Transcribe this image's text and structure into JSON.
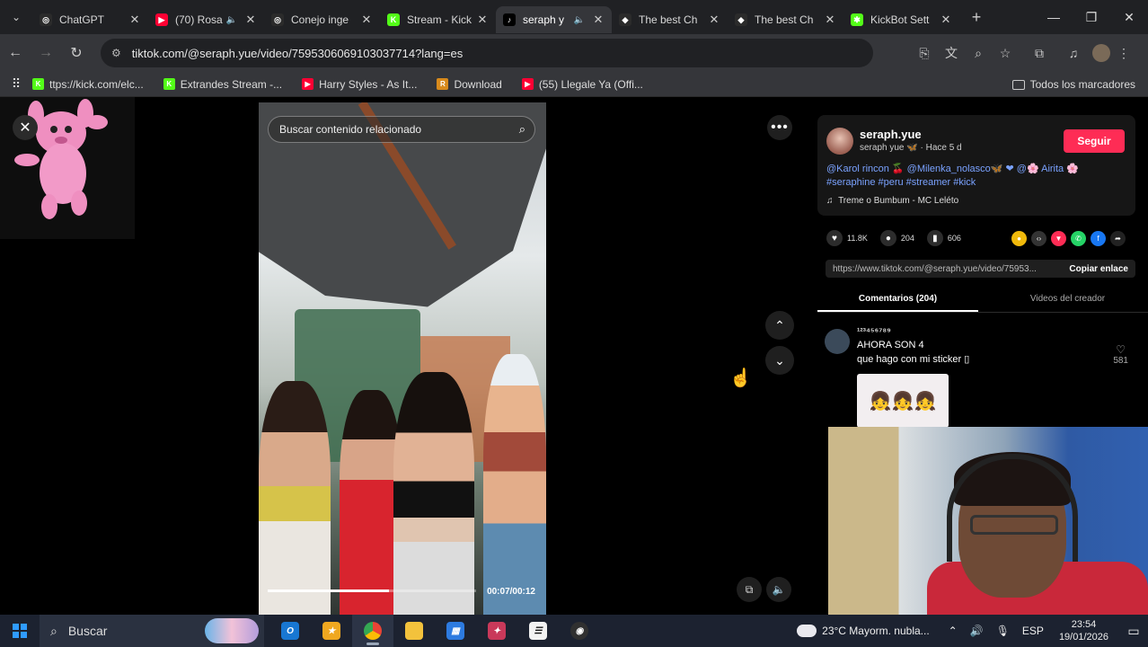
{
  "tabs": [
    {
      "label": "ChatGPT",
      "color": "#2b2b2b",
      "glyph": "◎",
      "active": false,
      "audio": false
    },
    {
      "label": "(70) Rosa",
      "color": "#ff0033",
      "glyph": "▶",
      "active": false,
      "audio": true
    },
    {
      "label": "Conejo inge",
      "color": "#2b2b2b",
      "glyph": "◎",
      "active": false,
      "audio": false
    },
    {
      "label": "Stream - Kick",
      "color": "#53fc18",
      "glyph": "K",
      "active": false,
      "audio": false
    },
    {
      "label": "seraph y",
      "color": "#000000",
      "glyph": "♪",
      "active": true,
      "audio": true
    },
    {
      "label": "The best Ch",
      "color": "#2b2b2b",
      "glyph": "◆",
      "active": false,
      "audio": false
    },
    {
      "label": "The best Ch",
      "color": "#2b2b2b",
      "glyph": "◆",
      "active": false,
      "audio": false
    },
    {
      "label": "KickBot Sett",
      "color": "#53fc18",
      "glyph": "✱",
      "active": false,
      "audio": false
    }
  ],
  "address": {
    "url": "tiktok.com/@seraph.yue/video/7595306069103037714?lang=es"
  },
  "bookmarks": [
    {
      "label": "ttps://kick.com/elc...",
      "color": "#53fc18",
      "glyph": "K"
    },
    {
      "label": "Extrandes Stream -...",
      "color": "#53fc18",
      "glyph": "K"
    },
    {
      "label": "Harry Styles - As It...",
      "color": "#ff0033",
      "glyph": "▶"
    },
    {
      "label": "Download",
      "color": "#d88a1c",
      "glyph": "R"
    },
    {
      "label": "(55) Llegale Ya (Offi...",
      "color": "#ff0033",
      "glyph": "▶"
    }
  ],
  "all_bookmarks": "Todos los marcadores",
  "video": {
    "search_placeholder": "Buscar contenido relacionado",
    "timecode": "00:07/00:12",
    "progress_fraction": 0.58
  },
  "author": {
    "name": "seraph.yue",
    "subtitle": "seraph yue 🦋 · Hace 5 d",
    "follow_label": "Seguir",
    "description": "@Karol rincon 🍒 @Milenka_nolasco🦋 ❤ @🌸 Airita 🌸 #seraphine #peru #streamer #kick",
    "music": "Treme o Bumbum - MC Leléto"
  },
  "stats": {
    "likes": "11.8K",
    "comments": "204",
    "saves": "606"
  },
  "share": {
    "link": "https://www.tiktok.com/@seraph.yue/video/75953...",
    "copy_label": "Copiar enlace",
    "icons": [
      {
        "name": "coin",
        "color": "#f0b90b"
      },
      {
        "name": "embed",
        "color": "#333333"
      },
      {
        "name": "send",
        "color": "#fe2c55"
      },
      {
        "name": "whatsapp",
        "color": "#25d366"
      },
      {
        "name": "facebook",
        "color": "#1877f2"
      },
      {
        "name": "share",
        "color": "#222222"
      }
    ]
  },
  "comment_tabs": {
    "comments": "Comentarios (204)",
    "creator": "Videos del creador"
  },
  "comment": {
    "user": "¹²³⁴⁵⁶⁷⁸⁹",
    "line1": "AHORA SON 4",
    "line2": "que hago con mi sticker ▯",
    "likes": "581"
  },
  "taskbar": {
    "search": "Buscar",
    "weather": "23°C  Mayorm. nubla...",
    "lang": "ESP",
    "time": "23:54",
    "date": "19/01/2026"
  }
}
